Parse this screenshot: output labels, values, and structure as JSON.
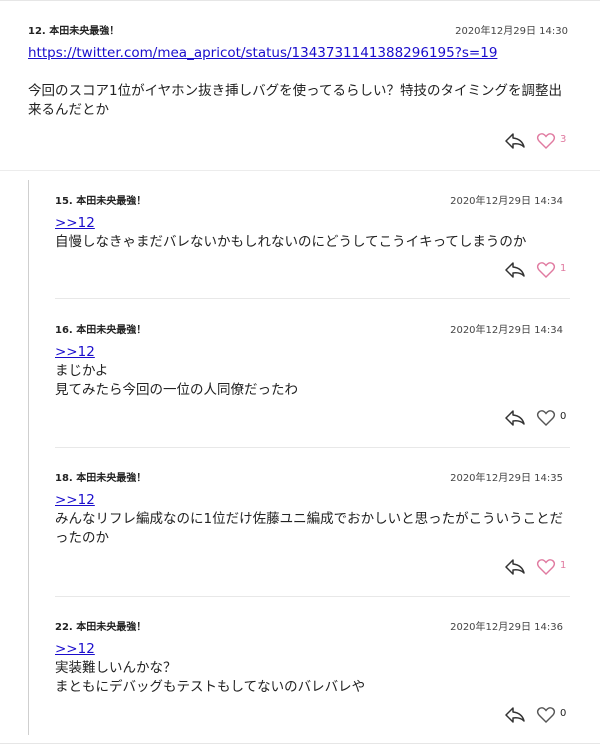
{
  "posts": [
    {
      "number_name": "12. 本田未央最強！",
      "date": "2020年12月29日 14:30",
      "lines": [
        "https://twitter.com/mea_apricot/status/1343731141388296195?s=19",
        "",
        "今回のスコア1位がイヤホン抜き挿しバグを使ってるらしい？特技のタイミングを調整出",
        "来るんだとか"
      ],
      "likes": "3",
      "liked": true
    },
    {
      "number_name": "15. 本田未央最強！",
      "date": "2020年12月29日 14:34",
      "anchor": ">>12",
      "lines": [
        "自慢しなきゃまだバレないかもしれないのにどうしてこうイキってしまうのか"
      ],
      "likes": "1",
      "liked": true
    },
    {
      "number_name": "16. 本田未央最強！",
      "date": "2020年12月29日 14:34",
      "anchor": ">>12",
      "lines": [
        "まじかよ",
        "見てみたら今回の一位の人同僚だったわ"
      ],
      "likes": "0",
      "liked": false
    },
    {
      "number_name": "18. 本田未央最強！",
      "date": "2020年12月29日 14:35",
      "anchor": ">>12",
      "lines": [
        "みんなリフレ編成なのに1位だけ佐藤ユニ編成でおかしいと思ったがこういうことだ",
        "ったのか"
      ],
      "likes": "1",
      "liked": true
    },
    {
      "number_name": "22. 本田未央最強！",
      "date": "2020年12月29日 14:36",
      "anchor": ">>12",
      "lines": [
        "実装難しいんかな？",
        "まともにデバッグもテストもしてないのバレバレや"
      ],
      "likes": "0",
      "liked": false
    }
  ],
  "icons": {
    "reply": "reply-arrow-icon",
    "like": "heart-icon"
  },
  "colors": {
    "link": "#1a0dcc",
    "liked_heart": "#e07aa0",
    "unliked_heart": "#555555"
  }
}
